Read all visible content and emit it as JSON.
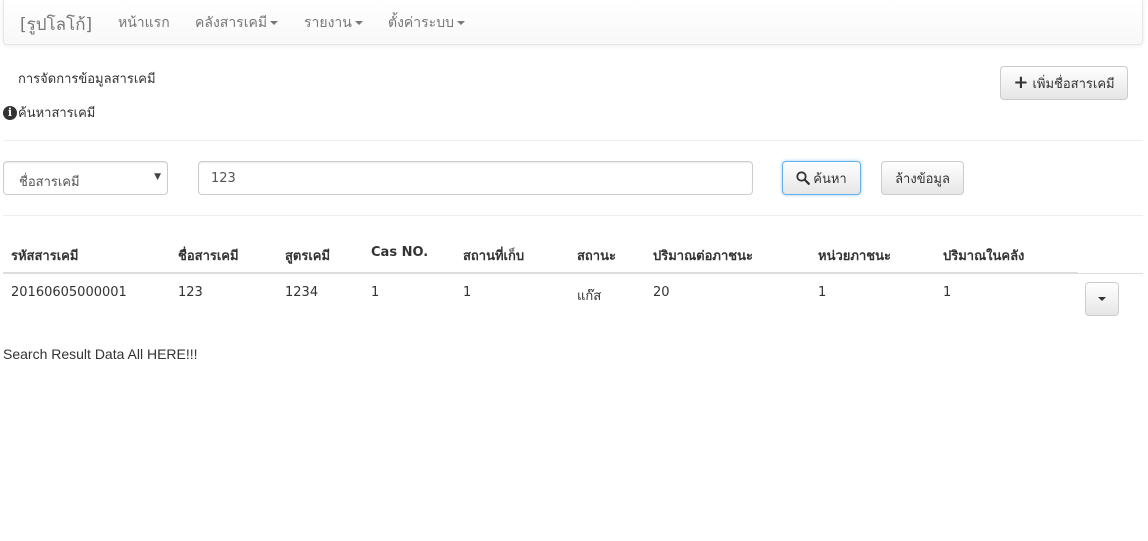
{
  "navbar": {
    "brand": "[รูปโลโก้]",
    "items": [
      {
        "label": "หน้าแรก",
        "dropdown": false
      },
      {
        "label": "คลังสารเคมี",
        "dropdown": true
      },
      {
        "label": "รายงาน",
        "dropdown": true
      },
      {
        "label": "ตั้งค่าระบบ",
        "dropdown": true
      }
    ]
  },
  "page": {
    "heading": "การจัดการข้อมูลสารเคมี",
    "add_button_label": "เพิ่มชื่อสารเคมี",
    "add_button_icon": "plus-icon"
  },
  "search": {
    "heading": "ค้นหาสารเคมี",
    "heading_icon": "info-icon",
    "field_select_value": "ชื่อสารเคมี",
    "input_value": "123",
    "search_button_label": "ค้นหา",
    "search_button_icon": "search-icon",
    "clear_button_label": "ล้างข้อมูล"
  },
  "table": {
    "columns": [
      "รหัสสารเคมี",
      "ชื่อสารเคมี",
      "สูตรเคมี",
      "Cas NO.",
      "สถานที่เก็บ",
      "สถานะ",
      "ปริมาณต่อภาชนะ",
      "หน่วยภาชนะ",
      "ปริมาณในคลัง"
    ],
    "rows": [
      [
        "20160605000001",
        "123",
        "1234",
        "1",
        "1",
        "แก๊ส",
        "20",
        "1",
        "1"
      ]
    ]
  },
  "result_text": "Search Result Data All HERE!!!",
  "colors": {
    "focus_border": "#66afe9",
    "nav_text": "#777777",
    "table_border": "#dddddd"
  }
}
